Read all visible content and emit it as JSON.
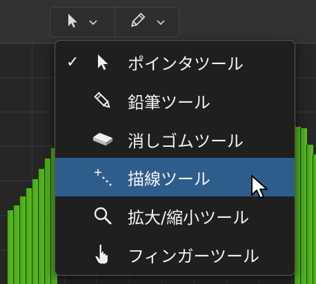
{
  "toolbar": {
    "left_tool_icon": "pointer-icon",
    "right_tool_icon": "pencil-icon"
  },
  "menu": {
    "items": [
      {
        "label": "ポインタツール",
        "icon": "pointer-icon",
        "checked": true
      },
      {
        "label": "鉛筆ツール",
        "icon": "pencil-icon",
        "checked": false
      },
      {
        "label": "消しゴムツール",
        "icon": "eraser-icon",
        "checked": false
      },
      {
        "label": "描線ツール",
        "icon": "line-draw-icon",
        "checked": false,
        "highlighted": true
      },
      {
        "label": "拡大/縮小ツール",
        "icon": "zoom-icon",
        "checked": false
      },
      {
        "label": "フィンガーツール",
        "icon": "finger-icon",
        "checked": false
      }
    ],
    "check_glyph": "✓"
  },
  "colors": {
    "highlight": "#2e5d8c",
    "bar_green": "#5cbf22",
    "menu_bg": "#1f1f1f"
  }
}
